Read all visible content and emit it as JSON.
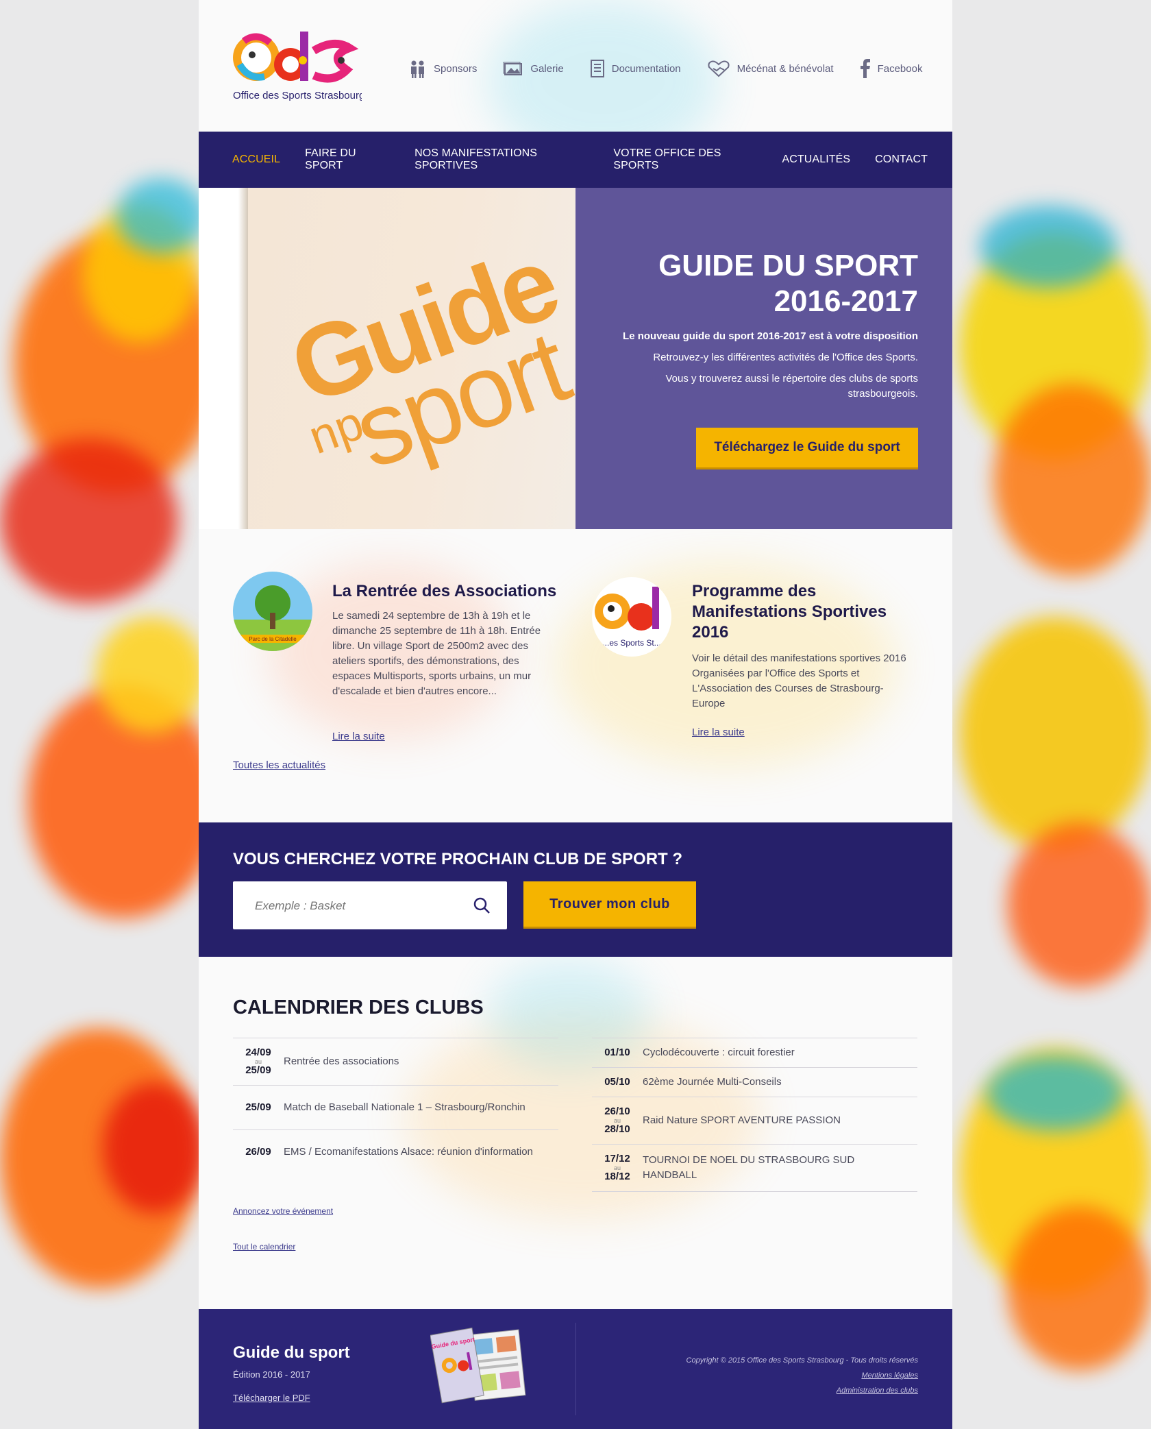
{
  "logo": {
    "letters": "OdS",
    "caption": "Office des Sports Strasbourg"
  },
  "toplinks": [
    {
      "label": "Sponsors",
      "icon": "sponsors-icon"
    },
    {
      "label": "Galerie",
      "icon": "gallery-icon"
    },
    {
      "label": "Documentation",
      "icon": "document-icon"
    },
    {
      "label": "Mécénat & bénévolat",
      "icon": "handshake-icon"
    },
    {
      "label": "Facebook",
      "icon": "facebook-icon"
    }
  ],
  "nav": [
    {
      "label": "ACCUEIL",
      "active": true
    },
    {
      "label": "FAIRE DU SPORT"
    },
    {
      "label": "NOS MANIFESTATIONS SPORTIVES"
    },
    {
      "label": "VOTRE OFFICE DES SPORTS"
    },
    {
      "label": "ACTUALITÉS"
    },
    {
      "label": "CONTACT"
    }
  ],
  "hero": {
    "image_words": {
      "guide": "Guide",
      "du": "du",
      "sport": "sport"
    },
    "title_line1": "GUIDE DU SPORT",
    "title_line2": "2016-2017",
    "lead": "Le nouveau guide du sport 2016-2017 est à votre disposition",
    "p1": "Retrouvez-y les différentes activités de l'Office des Sports.",
    "p2": "Vous y trouverez aussi le répertoire des clubs de sports strasbourgeois.",
    "button": "Téléchargez le Guide du sport"
  },
  "news": [
    {
      "title": "La Rentrée des Associations",
      "thumb_caption": "Parc de la Citadelle",
      "body": "Le samedi 24 septembre de 13h à 19h et le dimanche 25 septembre de 11h à 18h. Entrée libre. Un village Sport de 2500m2 avec des ateliers sportifs, des démonstrations, des espaces Multisports, sports urbains, un mur d'escalade et bien d'autres encore...",
      "more": "Lire la suite"
    },
    {
      "title": "Programme des Manifestations Sportives 2016",
      "thumb_caption": "...es Sports St...",
      "body": "Voir le détail des manifestations sportives 2016 Organisées par l'Office des Sports et L'Association des Courses de Strasbourg-Europe",
      "more": "Lire la suite"
    }
  ],
  "all_news": "Toutes les actualités",
  "search": {
    "heading": "VOUS CHERCHEZ VOTRE PROCHAIN CLUB DE SPORT ?",
    "placeholder": "Exemple : Basket",
    "button": "Trouver mon club"
  },
  "calendar": {
    "heading": "CALENDRIER DES CLUBS",
    "left": [
      {
        "from": "24/09",
        "au": "au",
        "to": "25/09",
        "text": "Rentrée des associations"
      },
      {
        "from": "25/09",
        "text": "Match de Baseball Nationale 1 – Strasbourg/Ronchin"
      },
      {
        "from": "26/09",
        "text": "EMS / Ecomanifestations Alsace: réunion d'information"
      }
    ],
    "right": [
      {
        "from": "01/10",
        "text": "Cyclodécouverte : circuit forestier"
      },
      {
        "from": "05/10",
        "text": "62ème Journée Multi-Conseils"
      },
      {
        "from": "26/10",
        "au": "au",
        "to": "28/10",
        "text": "Raid Nature SPORT AVENTURE PASSION"
      },
      {
        "from": "17/12",
        "au": "au",
        "to": "18/12",
        "text": "TOURNOI DE NOEL DU STRASBOURG SUD HANDBALL"
      }
    ],
    "announce": "Annoncez votre événement",
    "all": "Tout le calendrier"
  },
  "footer": {
    "title": "Guide du sport",
    "edition": "Édition 2016 - 2017",
    "download": "Télécharger le PDF",
    "book_cover": "Guide du sport",
    "copyright": "Copyright © 2015 Office des Sports Strasbourg - Tous droits réservés",
    "legal": "Mentions légales",
    "admin": "Administration des clubs"
  },
  "colors": {
    "nav_bg": "#26206a",
    "accent": "#f5b400",
    "hero_panel": "#5f5599",
    "footer_bg": "#2c2577"
  }
}
